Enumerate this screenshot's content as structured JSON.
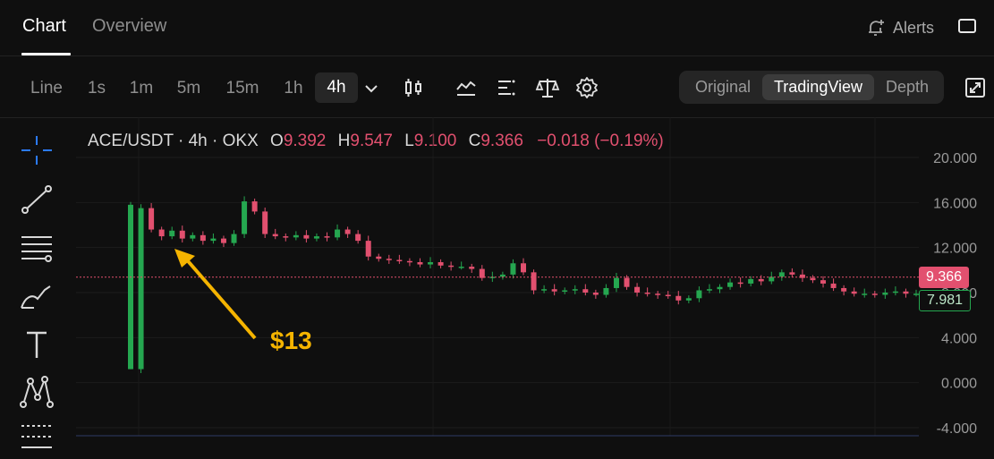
{
  "header": {
    "tabs": [
      {
        "label": "Chart",
        "active": true
      },
      {
        "label": "Overview",
        "active": false
      }
    ],
    "alerts_label": "Alerts"
  },
  "toolbar": {
    "intervals": [
      "Line",
      "1s",
      "1m",
      "5m",
      "15m",
      "1h",
      "4h"
    ],
    "active_interval": "4h",
    "icons": [
      "chevron-down-icon",
      "candlestick-icon",
      "indicators-icon",
      "list-settings-icon",
      "scale-icon",
      "gear-icon"
    ],
    "views": [
      "Original",
      "TradingView",
      "Depth"
    ],
    "active_view": "TradingView"
  },
  "left_tools": [
    "crosshair-icon",
    "trend-line-icon",
    "horizontal-lines-icon",
    "brush-icon",
    "text-icon",
    "pattern-icon",
    "measure-icon"
  ],
  "legend": {
    "symbol": "ACE/USDT · 4h · OKX",
    "o_label": "O",
    "o": "9.392",
    "h_label": "H",
    "h": "9.547",
    "l_label": "L",
    "l": "9.100",
    "c_label": "C",
    "c": "9.366",
    "change": "−0.018 (−0.19%)"
  },
  "price_tags": {
    "last": "9.366",
    "secondary": "7.981"
  },
  "annotation": {
    "text": "$13"
  },
  "colors": {
    "background": "#0f0f0f",
    "up": "#25a750",
    "down": "#e2506f",
    "accent": "#f5b400",
    "crosshair": "#2b7bff"
  },
  "chart_data": {
    "type": "candlestick",
    "ylim": [
      -4,
      20
    ],
    "y_ticks": [
      "20.000",
      "16.000",
      "12.000",
      "8.000",
      "4.000",
      "0.000",
      "-4.000"
    ],
    "close_series": [
      1.2,
      15.5,
      13.6,
      13.0,
      13.5,
      12.8,
      13.1,
      12.6,
      12.8,
      12.4,
      13.2,
      16.1,
      15.2,
      13.2,
      13.0,
      12.9,
      13.1,
      12.8,
      13.0,
      12.9,
      13.6,
      13.2,
      12.6,
      11.2,
      11.0,
      10.9,
      10.8,
      10.7,
      10.5,
      10.7,
      10.4,
      10.3,
      10.3,
      10.1,
      9.3,
      9.4,
      9.6,
      10.6,
      9.8,
      8.2,
      8.3,
      8.1,
      8.2,
      8.3,
      8.0,
      7.8,
      8.4,
      9.3,
      8.5,
      8.0,
      7.9,
      7.8,
      7.7,
      7.3,
      7.5,
      8.2,
      8.3,
      8.5,
      8.9,
      8.8,
      9.2,
      9.0,
      9.4,
      9.8,
      9.6,
      9.3,
      9.1,
      8.8,
      8.4,
      8.1,
      7.9,
      7.9,
      7.8,
      8.0,
      8.1,
      7.9,
      7.9
    ],
    "last_price": 9.366
  }
}
